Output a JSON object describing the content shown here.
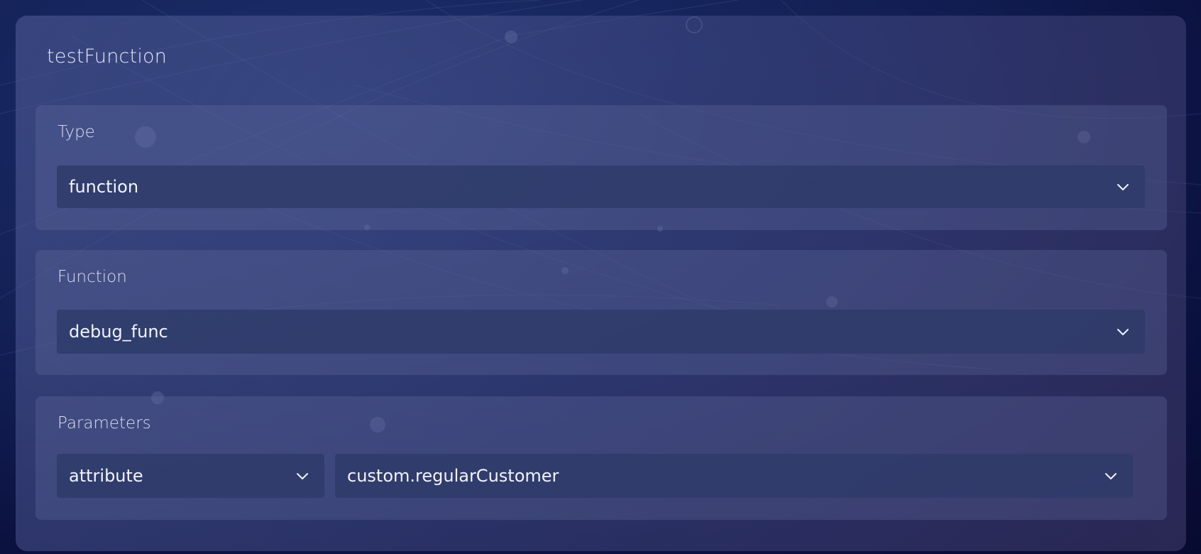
{
  "card": {
    "title": "testFunction"
  },
  "type_section": {
    "label": "Type",
    "value": "function"
  },
  "function_section": {
    "label": "Function",
    "value": "debug_func"
  },
  "parameters_section": {
    "label": "Parameters",
    "param_type": "attribute",
    "param_value": "custom.regularCustomer"
  },
  "icons": {
    "dropdown": "chevron-down-icon"
  },
  "colors": {
    "background": "#0b1240",
    "card": "#4a5290",
    "select": "#2d3a69",
    "text": "#f2f3fa"
  }
}
